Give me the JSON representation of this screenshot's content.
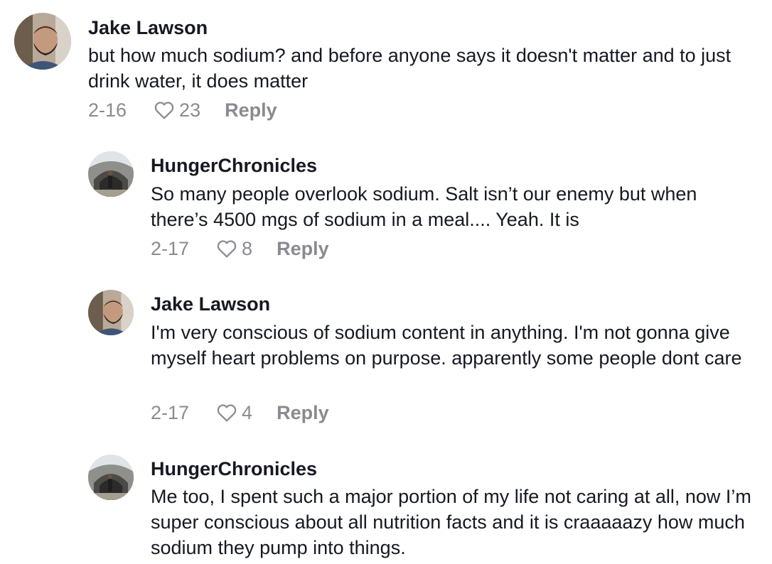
{
  "comments": [
    {
      "username": "Jake Lawson",
      "text": "but how much sodium? and before anyone says it doesn't matter and to just drink water, it does matter",
      "date": "2-16",
      "likes": "23",
      "reply_label": "Reply",
      "avatar_icon": "profile-photo-bearded-man"
    },
    {
      "username": "HungerChronicles",
      "text": "So many people overlook sodium. Salt isn’t our enemy but when there’s 4500 mgs of sodium in a meal.... Yeah. It is",
      "date": "2-17",
      "likes": "8",
      "reply_label": "Reply",
      "avatar_icon": "profile-photo-tunnel"
    },
    {
      "username": "Jake Lawson",
      "text": "I'm very conscious of sodium content in anything. I'm not gonna give myself heart problems on purpose. apparently some people dont care",
      "date": "2-17",
      "likes": "4",
      "reply_label": "Reply",
      "avatar_icon": "profile-photo-bearded-man"
    },
    {
      "username": "HungerChronicles",
      "text": "Me too, I spent such a major portion of my life not caring at all, now I’m super conscious about all nutrition facts and it is craaaaazy how much sodium they pump into things.",
      "date": "",
      "likes": "",
      "reply_label": "",
      "avatar_icon": "profile-photo-tunnel"
    }
  ],
  "colors": {
    "text_primary": "#161823",
    "text_secondary": "#8a8b91",
    "background": "#ffffff"
  }
}
